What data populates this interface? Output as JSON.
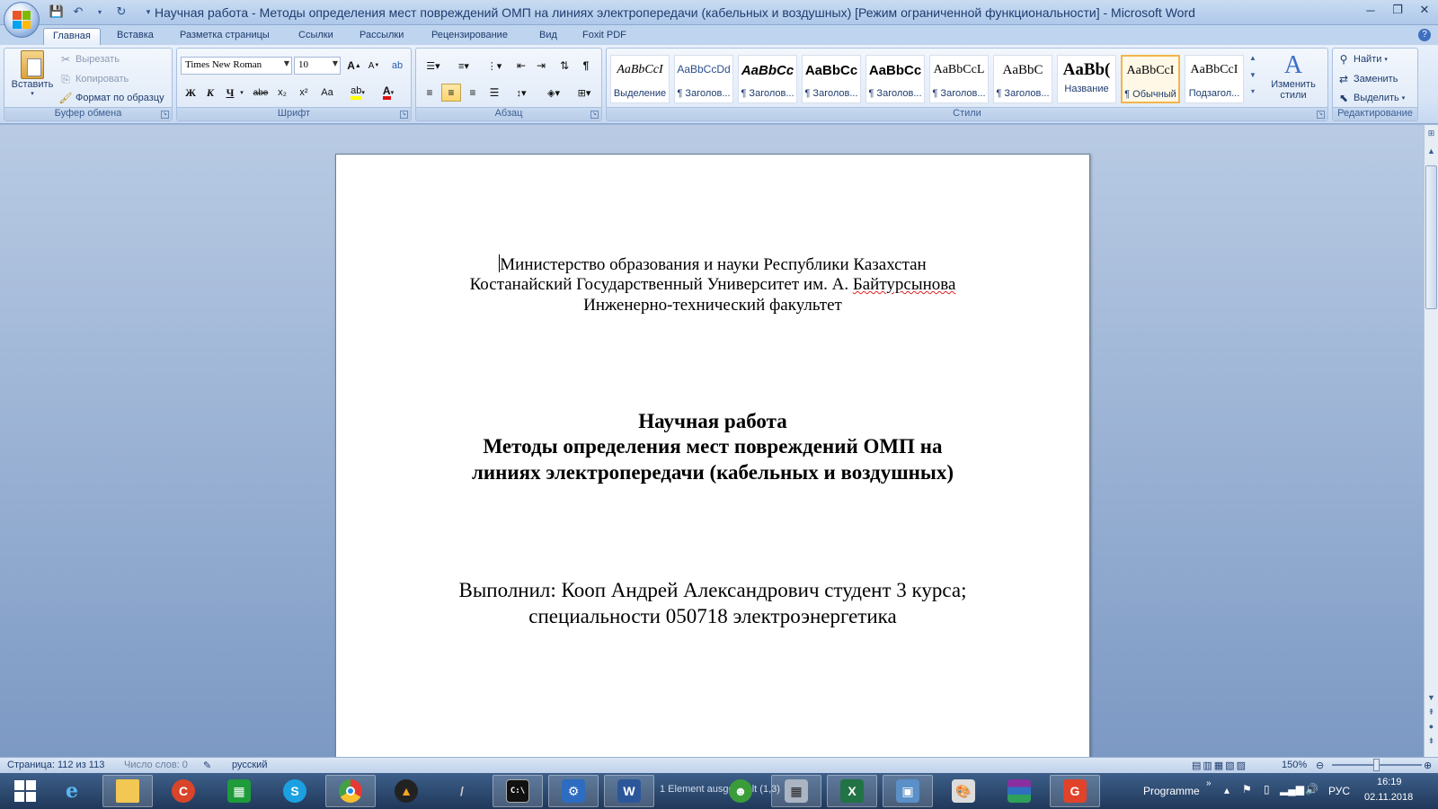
{
  "window": {
    "title": "Научная работа - Методы определения мест повреждений ОМП на линиях электропередачи (кабельных и воздушных) [Режим ограниченной функциональности] - Microsoft Word"
  },
  "tabs": [
    "Главная",
    "Вставка",
    "Разметка страницы",
    "Ссылки",
    "Рассылки",
    "Рецензирование",
    "Вид",
    "Foxit PDF"
  ],
  "ribbon": {
    "clipboard": {
      "label": "Буфер обмена",
      "paste": "Вставить",
      "cut": "Вырезать",
      "copy": "Копировать",
      "format_painter": "Формат по образцу"
    },
    "font": {
      "label": "Шрифт",
      "font_name": "Times New Roman",
      "font_size": "10",
      "bold": "Ж",
      "italic": "К",
      "underline": "Ч",
      "strike": "abe",
      "subscript": "x₂",
      "superscript": "x²",
      "change_case": "Aa"
    },
    "paragraph": {
      "label": "Абзац"
    },
    "styles": {
      "label": "Стили",
      "items": [
        {
          "sample": "AaBbCcI",
          "name": "Выделение"
        },
        {
          "sample": "AaBbCcDd",
          "name": "¶ Заголов..."
        },
        {
          "sample": "AaBbCc",
          "name": "¶ Заголов..."
        },
        {
          "sample": "AaBbCc",
          "name": "¶ Заголов..."
        },
        {
          "sample": "AaBbCc",
          "name": "¶ Заголов..."
        },
        {
          "sample": "AaBbCcL",
          "name": "¶ Заголов..."
        },
        {
          "sample": "AaBbC",
          "name": "¶ Заголов..."
        },
        {
          "sample": "AaBb(",
          "name": "Название"
        },
        {
          "sample": "AaBbCcI",
          "name": "¶ Обычный"
        },
        {
          "sample": "AaBbCcI",
          "name": "Подзагол..."
        }
      ],
      "change_styles": "Изменить стили"
    },
    "editing": {
      "label": "Редактирование",
      "find": "Найти",
      "replace": "Заменить",
      "select": "Выделить"
    }
  },
  "document": {
    "header_lines": [
      "Министерство образования и науки Республики Казахстан",
      "Костанайский Государственный Университет им. А. ",
      "Байтурсынова",
      "Инженерно-технический факультет"
    ],
    "title_lines": [
      "Научная работа",
      "Методы определения мест повреждений ОМП на",
      "линиях электропередачи (кабельных и воздушных)"
    ],
    "author_lines": [
      "Выполнил: Кооп Андрей Александрович студент 3 курса;",
      "специальности 050718 электроэнергетика"
    ]
  },
  "statusbar": {
    "page": "Страница: 112 из 113",
    "words": "Число слов: 0",
    "language": "русский",
    "zoom": "150%"
  },
  "taskbar": {
    "clock_time": "16:19",
    "clock_date": "02.11.2018",
    "language": "РУС",
    "programme": "Programme",
    "overlap_text": "1 Element ausgewählt (1,3)"
  }
}
